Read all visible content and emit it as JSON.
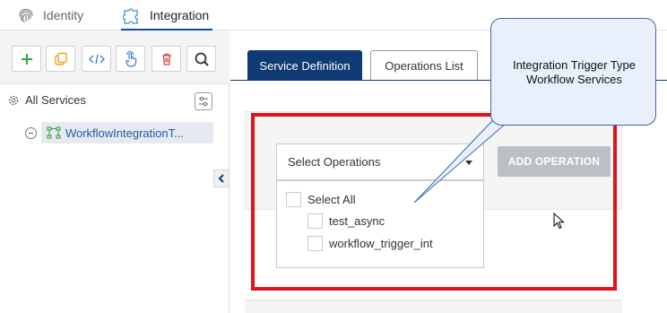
{
  "topnav": {
    "tabs": [
      {
        "label": "Identity",
        "icon": "fingerprint-icon"
      },
      {
        "label": "Integration",
        "icon": "puzzle-icon"
      }
    ]
  },
  "toolbar": {
    "buttons": [
      {
        "icon": "plus-icon",
        "color": "#3aa53a"
      },
      {
        "icon": "copy-icon",
        "color": "#f0a21c"
      },
      {
        "icon": "code-icon",
        "color": "#3b7cc8"
      },
      {
        "icon": "touch-icon",
        "color": "#3b7cc8"
      },
      {
        "icon": "trash-icon",
        "color": "#d04848"
      },
      {
        "icon": "search-icon",
        "color": "#333333"
      }
    ]
  },
  "tree": {
    "root_label": "All Services",
    "child_label": "WorkflowIntegrationT..."
  },
  "main": {
    "tabs": [
      {
        "label": "Service Definition",
        "active": true
      },
      {
        "label": "Operations List",
        "active": false
      }
    ],
    "select_label": "Select Operations",
    "add_button_label": "ADD OPERATION",
    "options": {
      "select_all": "Select All",
      "items": [
        "test_async",
        "workflow_trigger_int"
      ]
    }
  },
  "callout": {
    "line1": "Integration Trigger Type",
    "line2": "Workflow Services"
  },
  "colors": {
    "accent": "#0f3a73",
    "highlight": "#e0121d",
    "link": "#1a5ea8",
    "disabled": "#bcc0c4"
  }
}
